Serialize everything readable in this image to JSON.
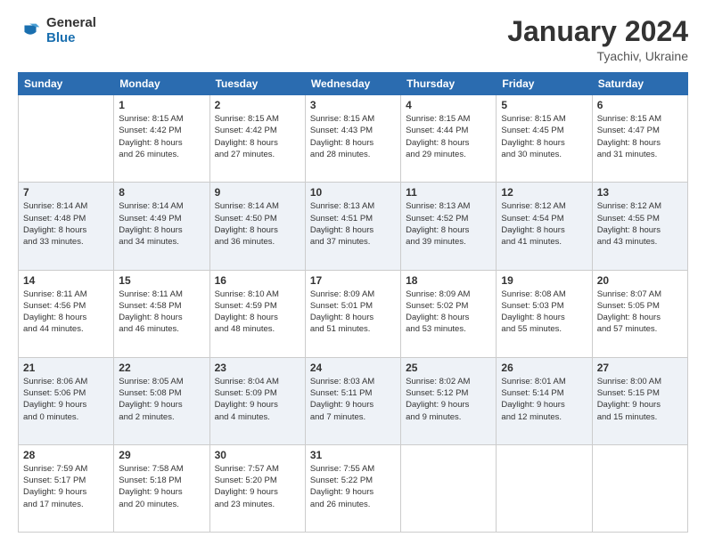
{
  "logo": {
    "general": "General",
    "blue": "Blue"
  },
  "title": "January 2024",
  "location": "Tyachiv, Ukraine",
  "days_of_week": [
    "Sunday",
    "Monday",
    "Tuesday",
    "Wednesday",
    "Thursday",
    "Friday",
    "Saturday"
  ],
  "weeks": [
    [
      {
        "day": "",
        "info": ""
      },
      {
        "day": "1",
        "info": "Sunrise: 8:15 AM\nSunset: 4:42 PM\nDaylight: 8 hours\nand 26 minutes."
      },
      {
        "day": "2",
        "info": "Sunrise: 8:15 AM\nSunset: 4:42 PM\nDaylight: 8 hours\nand 27 minutes."
      },
      {
        "day": "3",
        "info": "Sunrise: 8:15 AM\nSunset: 4:43 PM\nDaylight: 8 hours\nand 28 minutes."
      },
      {
        "day": "4",
        "info": "Sunrise: 8:15 AM\nSunset: 4:44 PM\nDaylight: 8 hours\nand 29 minutes."
      },
      {
        "day": "5",
        "info": "Sunrise: 8:15 AM\nSunset: 4:45 PM\nDaylight: 8 hours\nand 30 minutes."
      },
      {
        "day": "6",
        "info": "Sunrise: 8:15 AM\nSunset: 4:47 PM\nDaylight: 8 hours\nand 31 minutes."
      }
    ],
    [
      {
        "day": "7",
        "info": "Sunrise: 8:14 AM\nSunset: 4:48 PM\nDaylight: 8 hours\nand 33 minutes."
      },
      {
        "day": "8",
        "info": "Sunrise: 8:14 AM\nSunset: 4:49 PM\nDaylight: 8 hours\nand 34 minutes."
      },
      {
        "day": "9",
        "info": "Sunrise: 8:14 AM\nSunset: 4:50 PM\nDaylight: 8 hours\nand 36 minutes."
      },
      {
        "day": "10",
        "info": "Sunrise: 8:13 AM\nSunset: 4:51 PM\nDaylight: 8 hours\nand 37 minutes."
      },
      {
        "day": "11",
        "info": "Sunrise: 8:13 AM\nSunset: 4:52 PM\nDaylight: 8 hours\nand 39 minutes."
      },
      {
        "day": "12",
        "info": "Sunrise: 8:12 AM\nSunset: 4:54 PM\nDaylight: 8 hours\nand 41 minutes."
      },
      {
        "day": "13",
        "info": "Sunrise: 8:12 AM\nSunset: 4:55 PM\nDaylight: 8 hours\nand 43 minutes."
      }
    ],
    [
      {
        "day": "14",
        "info": "Sunrise: 8:11 AM\nSunset: 4:56 PM\nDaylight: 8 hours\nand 44 minutes."
      },
      {
        "day": "15",
        "info": "Sunrise: 8:11 AM\nSunset: 4:58 PM\nDaylight: 8 hours\nand 46 minutes."
      },
      {
        "day": "16",
        "info": "Sunrise: 8:10 AM\nSunset: 4:59 PM\nDaylight: 8 hours\nand 48 minutes."
      },
      {
        "day": "17",
        "info": "Sunrise: 8:09 AM\nSunset: 5:01 PM\nDaylight: 8 hours\nand 51 minutes."
      },
      {
        "day": "18",
        "info": "Sunrise: 8:09 AM\nSunset: 5:02 PM\nDaylight: 8 hours\nand 53 minutes."
      },
      {
        "day": "19",
        "info": "Sunrise: 8:08 AM\nSunset: 5:03 PM\nDaylight: 8 hours\nand 55 minutes."
      },
      {
        "day": "20",
        "info": "Sunrise: 8:07 AM\nSunset: 5:05 PM\nDaylight: 8 hours\nand 57 minutes."
      }
    ],
    [
      {
        "day": "21",
        "info": "Sunrise: 8:06 AM\nSunset: 5:06 PM\nDaylight: 9 hours\nand 0 minutes."
      },
      {
        "day": "22",
        "info": "Sunrise: 8:05 AM\nSunset: 5:08 PM\nDaylight: 9 hours\nand 2 minutes."
      },
      {
        "day": "23",
        "info": "Sunrise: 8:04 AM\nSunset: 5:09 PM\nDaylight: 9 hours\nand 4 minutes."
      },
      {
        "day": "24",
        "info": "Sunrise: 8:03 AM\nSunset: 5:11 PM\nDaylight: 9 hours\nand 7 minutes."
      },
      {
        "day": "25",
        "info": "Sunrise: 8:02 AM\nSunset: 5:12 PM\nDaylight: 9 hours\nand 9 minutes."
      },
      {
        "day": "26",
        "info": "Sunrise: 8:01 AM\nSunset: 5:14 PM\nDaylight: 9 hours\nand 12 minutes."
      },
      {
        "day": "27",
        "info": "Sunrise: 8:00 AM\nSunset: 5:15 PM\nDaylight: 9 hours\nand 15 minutes."
      }
    ],
    [
      {
        "day": "28",
        "info": "Sunrise: 7:59 AM\nSunset: 5:17 PM\nDaylight: 9 hours\nand 17 minutes."
      },
      {
        "day": "29",
        "info": "Sunrise: 7:58 AM\nSunset: 5:18 PM\nDaylight: 9 hours\nand 20 minutes."
      },
      {
        "day": "30",
        "info": "Sunrise: 7:57 AM\nSunset: 5:20 PM\nDaylight: 9 hours\nand 23 minutes."
      },
      {
        "day": "31",
        "info": "Sunrise: 7:55 AM\nSunset: 5:22 PM\nDaylight: 9 hours\nand 26 minutes."
      },
      {
        "day": "",
        "info": ""
      },
      {
        "day": "",
        "info": ""
      },
      {
        "day": "",
        "info": ""
      }
    ]
  ]
}
